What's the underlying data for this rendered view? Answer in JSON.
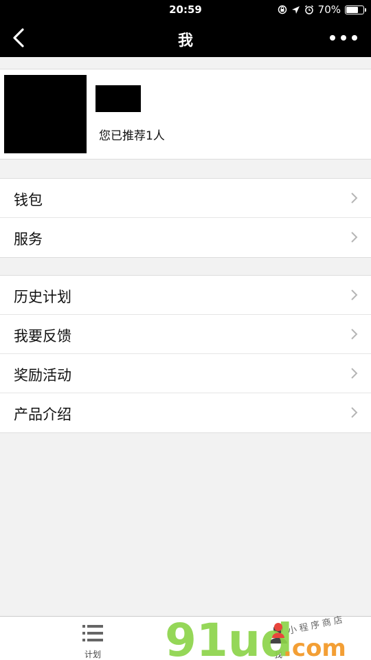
{
  "status_bar": {
    "time": "20:59",
    "battery": "70%",
    "battery_level": 0.7
  },
  "nav": {
    "title": "我"
  },
  "profile": {
    "referral_text": "您已推荐1人"
  },
  "menu_groups": [
    {
      "items": [
        {
          "label": "钱包"
        },
        {
          "label": "服务"
        }
      ]
    },
    {
      "items": [
        {
          "label": "历史计划"
        },
        {
          "label": "我要反馈"
        },
        {
          "label": "奖励活动"
        },
        {
          "label": "产品介绍"
        }
      ]
    }
  ],
  "tabs": [
    {
      "label": "计划"
    },
    {
      "label": "我"
    }
  ],
  "watermark": {
    "logo": "91ud",
    "suffix": ".com",
    "tagline": "小程序商店"
  },
  "colors": {
    "bar_bg": "#000000",
    "page_bg": "#f2f2f2",
    "watermark_green": "#8dd44a",
    "watermark_orange": "#f39a2b",
    "watermark_red": "#e8453c"
  }
}
